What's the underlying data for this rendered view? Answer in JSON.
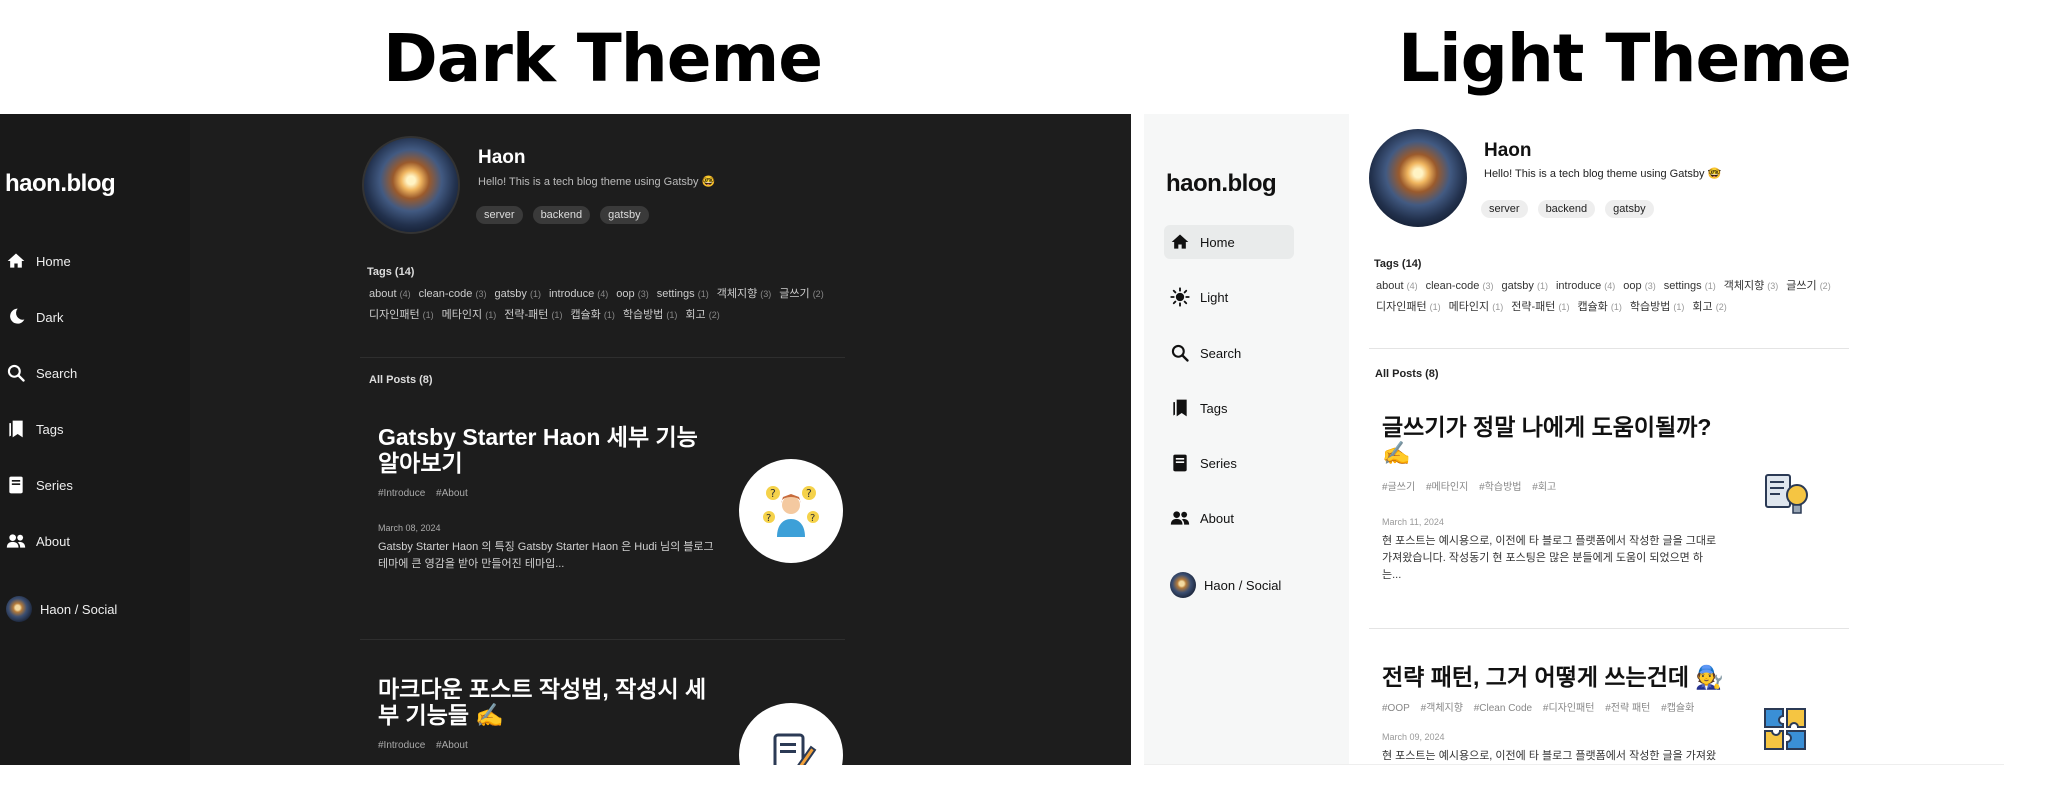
{
  "headings": {
    "dark": "Dark Theme",
    "light": "Light Theme"
  },
  "dark": {
    "brand": "haon.blog",
    "nav": [
      {
        "label": "Home",
        "icon": "home-icon"
      },
      {
        "label": "Dark",
        "icon": "moon-icon"
      },
      {
        "label": "Search",
        "icon": "search-icon"
      },
      {
        "label": "Tags",
        "icon": "bookmarks-icon"
      },
      {
        "label": "Series",
        "icon": "book-icon"
      },
      {
        "label": "About",
        "icon": "people-icon"
      },
      {
        "label": "Haon / Social",
        "icon": "avatar"
      }
    ],
    "profile": {
      "name": "Haon",
      "desc": "Hello! This is a tech blog theme using Gatsby 🤓",
      "chips": [
        "server",
        "backend",
        "gatsby"
      ]
    },
    "tags_title": "Tags (14)",
    "tags": [
      [
        "about",
        "(4)"
      ],
      [
        "clean-code",
        "(3)"
      ],
      [
        "gatsby",
        "(1)"
      ],
      [
        "introduce",
        "(4)"
      ],
      [
        "oop",
        "(3)"
      ],
      [
        "settings",
        "(1)"
      ],
      [
        "객체지향",
        "(3)"
      ],
      [
        "글쓰기",
        "(2)"
      ],
      [
        "디자인패턴",
        "(1)"
      ],
      [
        "메타인지",
        "(1)"
      ],
      [
        "전략-패턴",
        "(1)"
      ],
      [
        "캡슐화",
        "(1)"
      ],
      [
        "학습방법",
        "(1)"
      ],
      [
        "회고",
        "(2)"
      ]
    ],
    "all_posts": "All Posts (8)",
    "posts": [
      {
        "title": "Gatsby Starter Haon 세부 기능 알아보기",
        "tags": [
          "#Introduce",
          "#About"
        ],
        "date": "March 08, 2024",
        "excerpt": "Gatsby Starter Haon 의 특징 Gatsby Starter Haon 은 Hudi 님의 블로그 테마에 큰 영감을 받아 만들어진 테마입...",
        "thumb_icon": "thinking-person-icon"
      },
      {
        "title": "마크다운 포스트 작성법, 작성시 세부 기능들 ✍️",
        "tags": [
          "#Introduce",
          "#About"
        ],
        "date": "",
        "excerpt": "",
        "thumb_icon": "document-pen-icon"
      }
    ]
  },
  "light": {
    "brand": "haon.blog",
    "nav": [
      {
        "label": "Home",
        "icon": "home-icon"
      },
      {
        "label": "Light",
        "icon": "sun-icon"
      },
      {
        "label": "Search",
        "icon": "search-icon"
      },
      {
        "label": "Tags",
        "icon": "bookmarks-icon"
      },
      {
        "label": "Series",
        "icon": "book-icon"
      },
      {
        "label": "About",
        "icon": "people-icon"
      },
      {
        "label": "Haon / Social",
        "icon": "avatar"
      }
    ],
    "profile": {
      "name": "Haon",
      "desc": "Hello! This is a tech blog theme using Gatsby 🤓",
      "chips": [
        "server",
        "backend",
        "gatsby"
      ]
    },
    "tags_title": "Tags (14)",
    "tags": [
      [
        "about",
        "(4)"
      ],
      [
        "clean-code",
        "(3)"
      ],
      [
        "gatsby",
        "(1)"
      ],
      [
        "introduce",
        "(4)"
      ],
      [
        "oop",
        "(3)"
      ],
      [
        "settings",
        "(1)"
      ],
      [
        "객체지향",
        "(3)"
      ],
      [
        "글쓰기",
        "(2)"
      ],
      [
        "디자인패턴",
        "(1)"
      ],
      [
        "메타인지",
        "(1)"
      ],
      [
        "전략-패턴",
        "(1)"
      ],
      [
        "캡슐화",
        "(1)"
      ],
      [
        "학습방법",
        "(1)"
      ],
      [
        "회고",
        "(2)"
      ]
    ],
    "all_posts": "All Posts (8)",
    "posts": [
      {
        "title": "글쓰기가 정말 나에게 도움이될까? ✍️",
        "tags": [
          "#글쓰기",
          "#메타인지",
          "#학습방법",
          "#회고"
        ],
        "date": "March 11, 2024",
        "excerpt": "현 포스트는 예시용으로, 이전에 타 블로그 플랫폼에서 작성한 글을 그대로 가져왔습니다. 작성동기 현 포스팅은 많은 분들에게 도움이 되었으면 하는...",
        "thumb_icon": "idea-document-icon"
      },
      {
        "title": "전략 패턴, 그거 어떻게 쓰는건데 🧑‍🔧",
        "tags": [
          "#OOP",
          "#객체지향",
          "#Clean Code",
          "#디자인패턴",
          "#전략 패턴",
          "#캡슐화"
        ],
        "date": "March 09, 2024",
        "excerpt": "현 포스트는 예시용으로, 이전에 타 블로그 플랫폼에서 작성한 글을 가져왔으",
        "thumb_icon": "puzzle-icon"
      }
    ]
  }
}
